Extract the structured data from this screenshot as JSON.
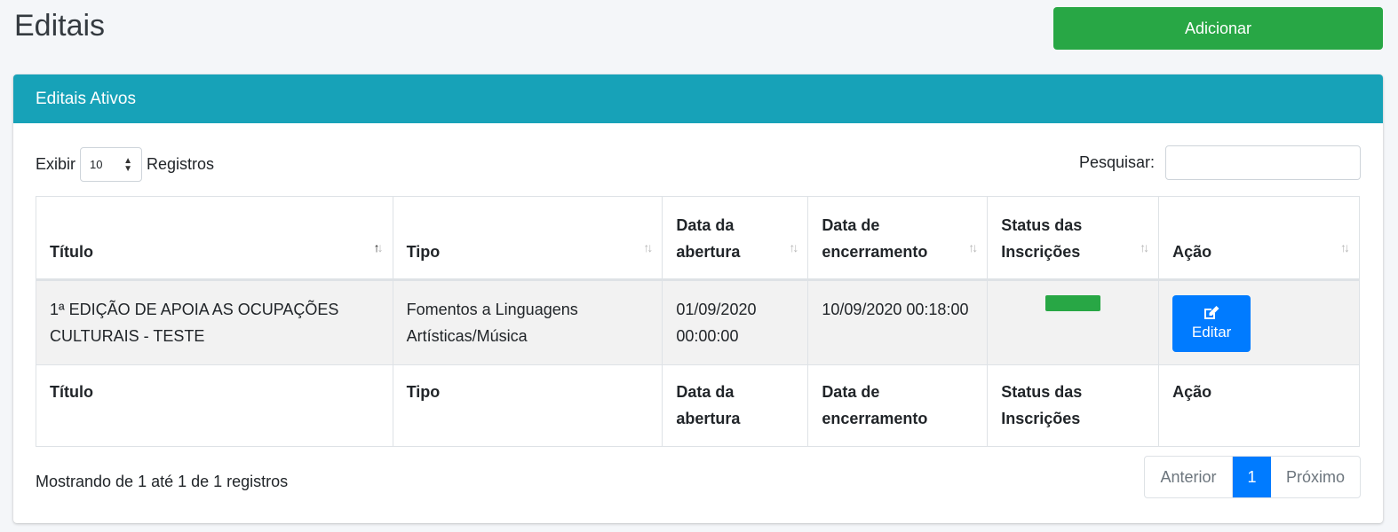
{
  "page": {
    "title": "Editais"
  },
  "actions": {
    "add_label": "Adicionar"
  },
  "card": {
    "header": "Editais Ativos"
  },
  "length": {
    "show_label": "Exibir",
    "value": "10",
    "suffix_label": "Registros"
  },
  "search": {
    "label": "Pesquisar:",
    "value": "",
    "placeholder": ""
  },
  "table": {
    "headers": {
      "titulo": "Título",
      "tipo": "Tipo",
      "abertura_1": "Data da",
      "abertura_2": "abertura",
      "encerramento_1": "Data de",
      "encerramento_2": "encerramento",
      "status_1": "Status das",
      "status_2": "Inscrições",
      "acao": "Ação"
    },
    "rows": [
      {
        "titulo_1": "1ª EDIÇÃO DE APOIA AS OCUPAÇÕES",
        "titulo_2": "CULTURAIS - TESTE",
        "tipo_1": "Fomentos a Linguagens",
        "tipo_2": "Artísticas/Música",
        "abertura_1": "01/09/2020",
        "abertura_2": "00:00:00",
        "encerramento": "10/09/2020 00:18:00",
        "status_color": "#28a745",
        "edit_label": "Editar",
        "edit_icon": "edit-icon"
      }
    ]
  },
  "info": "Mostrando de 1 até 1 de 1 registros",
  "pagination": {
    "prev": "Anterior",
    "current": "1",
    "next": "Próximo"
  },
  "colors": {
    "success": "#28a745",
    "info": "#17a2b8",
    "primary": "#007bff"
  }
}
